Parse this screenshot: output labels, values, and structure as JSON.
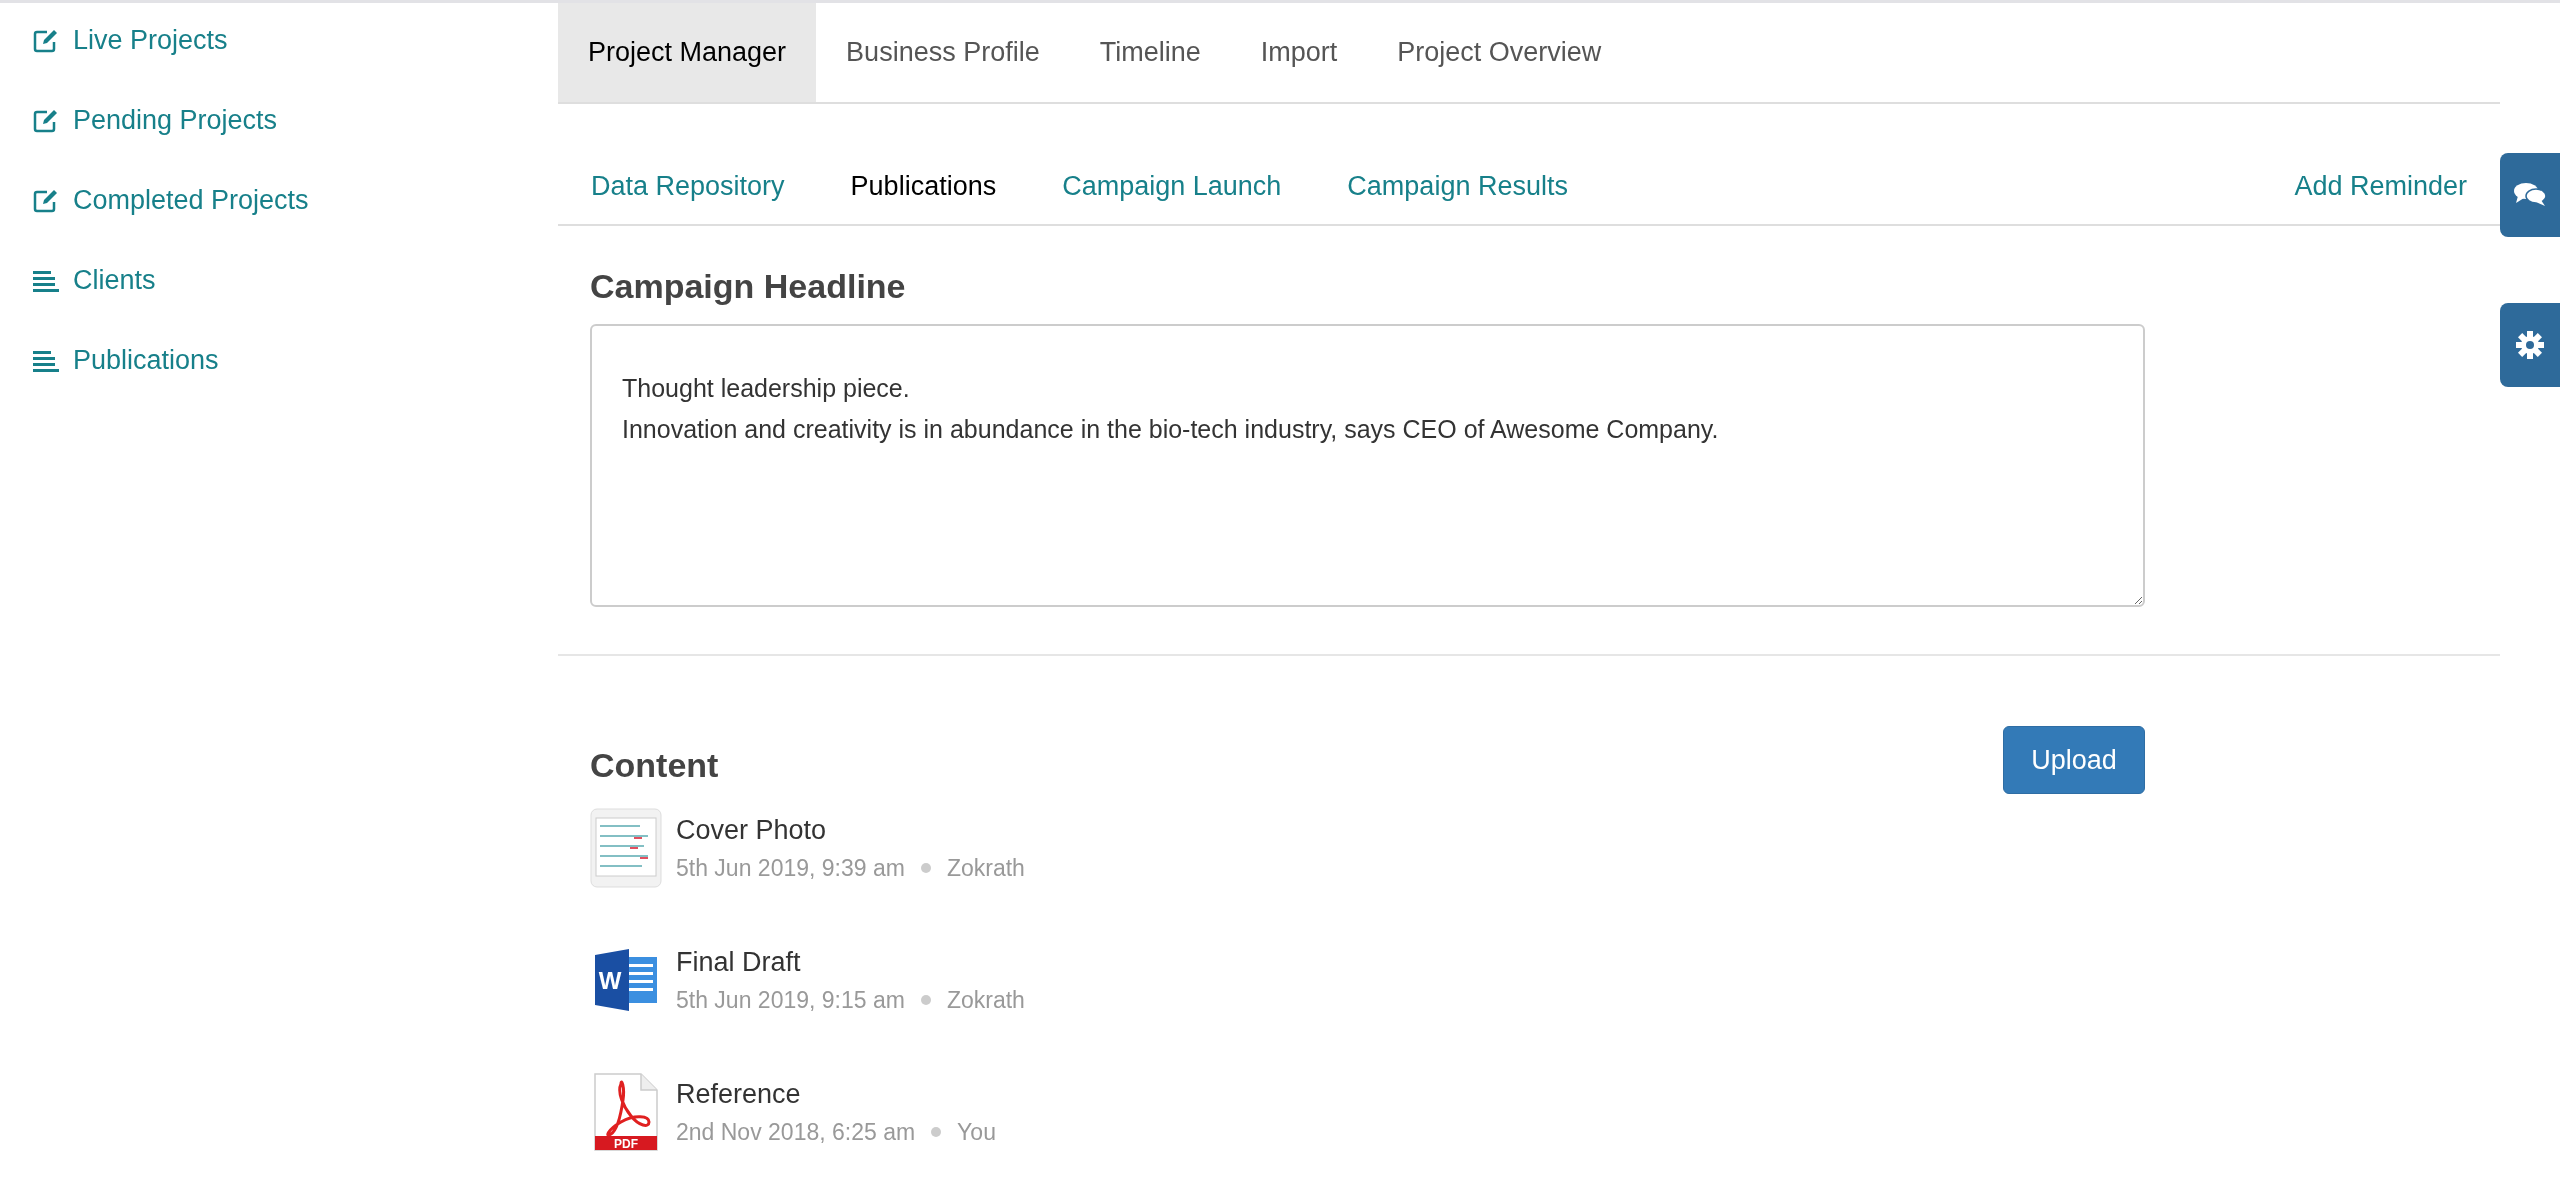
{
  "sidebar": {
    "items": [
      {
        "label": "Live Projects",
        "kind": "edit"
      },
      {
        "label": "Pending Projects",
        "kind": "edit"
      },
      {
        "label": "Completed Projects",
        "kind": "edit"
      },
      {
        "label": "Clients",
        "kind": "list"
      },
      {
        "label": "Publications",
        "kind": "list"
      }
    ]
  },
  "tabs": [
    {
      "label": "Project Manager",
      "selected": true
    },
    {
      "label": "Business Profile",
      "selected": false
    },
    {
      "label": "Timeline",
      "selected": false
    },
    {
      "label": "Import",
      "selected": false
    },
    {
      "label": "Project Overview",
      "selected": false
    }
  ],
  "subtabs": [
    {
      "label": "Data Repository",
      "selected": false
    },
    {
      "label": "Publications",
      "selected": true
    },
    {
      "label": "Campaign Launch",
      "selected": false
    },
    {
      "label": "Campaign Results",
      "selected": false
    }
  ],
  "add_reminder": "Add Reminder",
  "headline": {
    "title": "Campaign Headline",
    "value": "Thought leadership piece.\nInnovation and creativity is in abundance in the bio-tech industry, says CEO of Awesome Company."
  },
  "content": {
    "title": "Content",
    "upload": "Upload",
    "files": [
      {
        "kind": "image",
        "name": "Cover Photo",
        "date": "5th Jun 2019, 9:39 am",
        "author": "Zokrath"
      },
      {
        "kind": "word",
        "icon_text": "W",
        "name": "Final Draft",
        "date": "5th Jun 2019, 9:15 am",
        "author": "Zokrath"
      },
      {
        "kind": "pdf",
        "icon_text": "PDF",
        "name": "Reference",
        "date": "2nd Nov 2018, 6:25 am",
        "author": "You"
      }
    ]
  }
}
